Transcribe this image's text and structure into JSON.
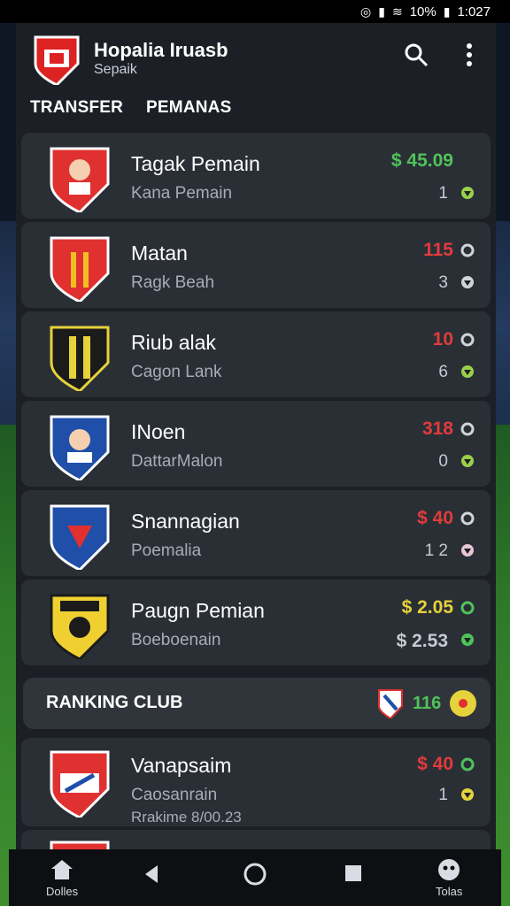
{
  "status_bar": {
    "battery": "10%",
    "time": "1:027"
  },
  "header": {
    "title": "Hopalia Iruasb",
    "subtitle": "Sepaik"
  },
  "tabs": [
    "TRANSFER",
    "PEMANAS"
  ],
  "players": [
    {
      "name": "Tagak Pemain",
      "sub": "Kana Pemain",
      "price": "$ 45.09",
      "price_color": "green",
      "num": "1",
      "status_top": "none",
      "status_bottom": "green"
    },
    {
      "name": "Matan",
      "sub": "Ragk Beah",
      "price": "115",
      "price_color": "red",
      "num": "3",
      "status_top": "grey",
      "status_bottom": "grey"
    },
    {
      "name": "Riub alak",
      "sub": "Cagon Lank",
      "price": "10",
      "price_color": "red",
      "num": "6",
      "status_top": "grey",
      "status_bottom": "green"
    },
    {
      "name": "INoen",
      "sub": "DattarMalon",
      "price": "318",
      "price_color": "red",
      "num": "0",
      "status_top": "grey",
      "status_bottom": "green"
    },
    {
      "name": "Snannagian",
      "sub": "Poemalia",
      "price": "$ 40",
      "price_color": "red",
      "num": "1 2",
      "status_top": "grey",
      "status_bottom": "grey"
    },
    {
      "name": "Paugn Pemian",
      "sub": "Boeboenain",
      "price": "$ 2.05",
      "price_color": "yellow",
      "num": "$ 2.53",
      "num_color": "green",
      "status_top": "green",
      "status_bottom": "green"
    }
  ],
  "ranking": {
    "label": "RANKING CLUB",
    "count": "116"
  },
  "featured": {
    "name": "Vanapsaim",
    "sub": "Caosanrain",
    "sub2": "Rrakime 8/00.23",
    "price": "$ 40",
    "num": "1",
    "status_top": "green",
    "status_bottom": "yellow"
  },
  "nav": {
    "left_label": "Dolles",
    "right_label": "Tolas"
  },
  "colors": {
    "green": "#4fc35a",
    "red": "#e23b3b",
    "yellow": "#e6d23a",
    "card": "#2a2f36"
  }
}
